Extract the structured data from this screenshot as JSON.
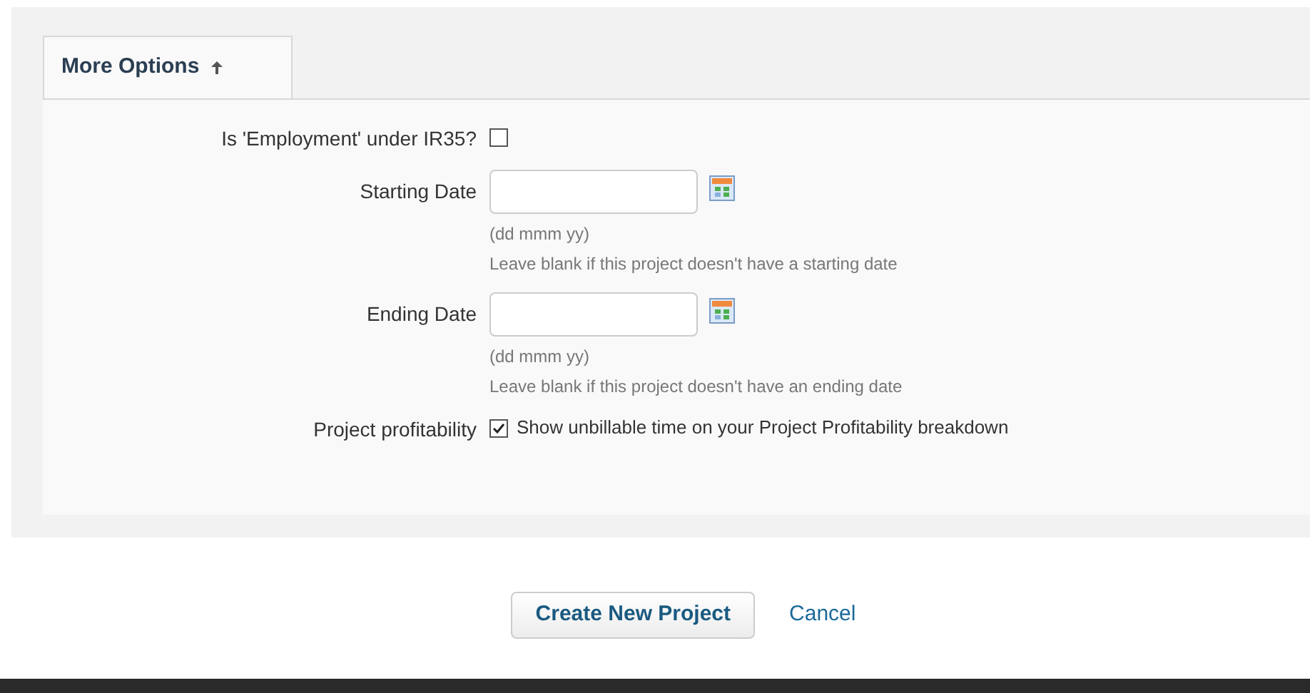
{
  "section": {
    "title": "More Options",
    "expanded": true
  },
  "fields": [
    {
      "kind": "checkbox",
      "label": "Is 'Employment' under IR35?",
      "checked": false
    },
    {
      "kind": "date",
      "label": "Starting Date",
      "format_hint": "(dd mmm yy)",
      "help": "Leave blank if this project doesn't have a starting date"
    },
    {
      "kind": "date",
      "label": "Ending Date",
      "format_hint": "(dd mmm yy)",
      "help": "Leave blank if this project doesn't have an ending date"
    },
    {
      "kind": "checkbox",
      "label": "Project profitability",
      "checked": true,
      "text": "Show unbillable time on your Project Profitability breakdown"
    }
  ],
  "actions": {
    "submit": "Create New Project",
    "cancel": "Cancel"
  }
}
